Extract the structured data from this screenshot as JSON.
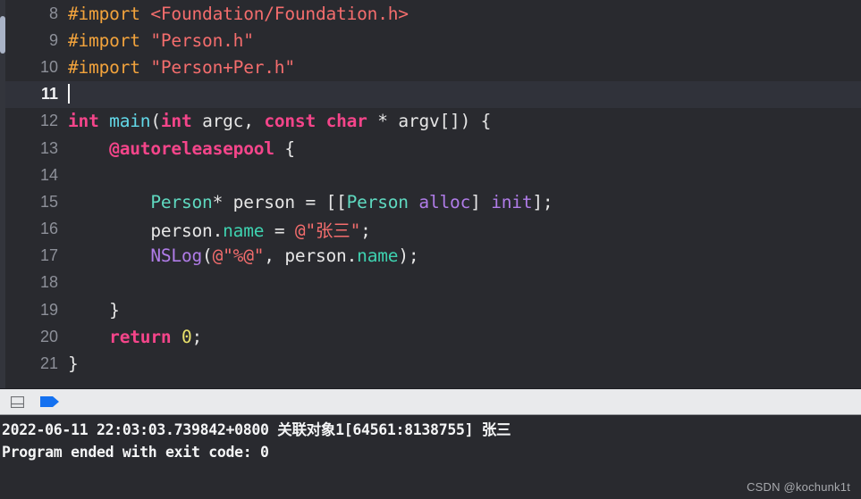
{
  "editor": {
    "background_color": "#292a2f",
    "active_line_color": "#30323a",
    "active_line_number": 11,
    "scrollbar": {
      "name": "vertical-scrollbar"
    },
    "lines": [
      {
        "number": "8",
        "text": "#import <Foundation/Foundation.h>"
      },
      {
        "number": "9",
        "text": "#import \"Person.h\""
      },
      {
        "number": "10",
        "text": "#import \"Person+Per.h\""
      },
      {
        "number": "11",
        "text": ""
      },
      {
        "number": "12",
        "text": "int main(int argc, const char * argv[]) {"
      },
      {
        "number": "13",
        "text": "    @autoreleasepool {"
      },
      {
        "number": "14",
        "text": ""
      },
      {
        "number": "15",
        "text": "        Person* person = [[Person alloc] init];"
      },
      {
        "number": "16",
        "text": "        person.name = @\"张三\";"
      },
      {
        "number": "17",
        "text": "        NSLog(@\"%@\", person.name);"
      },
      {
        "number": "18",
        "text": ""
      },
      {
        "number": "19",
        "text": "    }"
      },
      {
        "number": "20",
        "text": "    return 0;"
      },
      {
        "number": "21",
        "text": "}"
      }
    ],
    "tokens": {
      "preprocessor_color": "#f2a33c",
      "string_color": "#f46d6d",
      "keyword_color": "#f4458a",
      "type_color": "#5fd9c0",
      "property_color": "#3ed2b0",
      "function_color": "#62d8e8",
      "method_color": "#b07ce8",
      "number_color": "#e8e06a",
      "plain_color": "#e6e6e6"
    }
  },
  "console_toolbar": {
    "background_color": "#e9eaec",
    "icons": [
      {
        "name": "toggle-panel-icon",
        "label": "panel-toggle"
      },
      {
        "name": "filter-tag-icon",
        "label": "filter-tag",
        "color": "#1471f0"
      }
    ]
  },
  "console": {
    "background_color": "#292a2f",
    "lines": [
      "2022-06-11 22:03:03.739842+0800 关联对象1[64561:8138755] 张三",
      "Program ended with exit code: 0"
    ]
  },
  "watermark": {
    "text": "CSDN @kochunk1t"
  }
}
